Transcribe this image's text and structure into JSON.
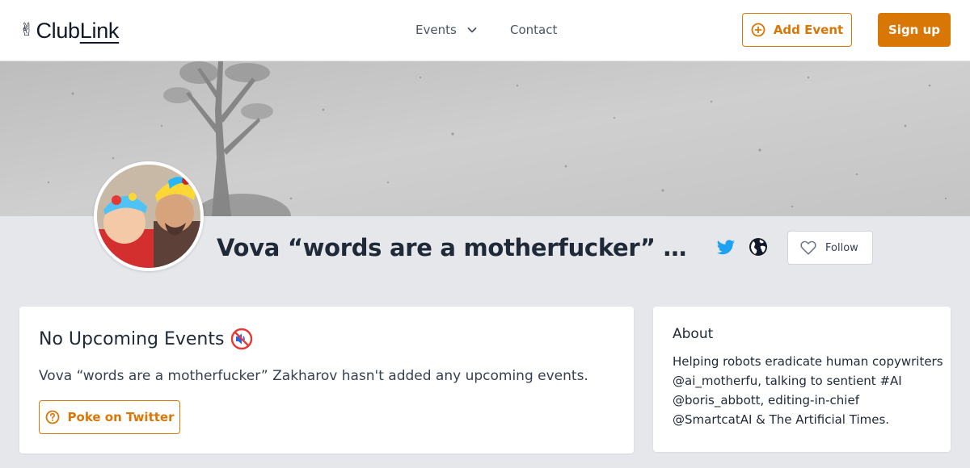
{
  "header": {
    "logo_hand": "✌",
    "logo_club": "Club",
    "logo_link": "Link",
    "nav": {
      "events_label": "Events",
      "contact_label": "Contact"
    },
    "add_event_label": "Add Event",
    "signup_label": "Sign up"
  },
  "profile": {
    "name": "Vova “words are a motherfucker” Zakharov",
    "follow_label": "Follow",
    "links": [
      "twitter-icon",
      "globe-icon"
    ]
  },
  "events": {
    "title": "No Upcoming Events",
    "title_icon": "muted-speaker-icon",
    "message": "Vova “words are a motherfucker” Zakharov hasn't added any upcoming events.",
    "poke_label": "Poke on Twitter"
  },
  "about": {
    "title": "About",
    "lines": [
      "Helping robots eradicate human copywriters",
      "@ai_motherfu, talking to sentient #AI",
      "@boris_abbott, editing-in-chief",
      "@SmartcatAI & The Artificial Times."
    ]
  },
  "colors": {
    "accent": "#d97706",
    "background": "#e5e7eb",
    "twitter": "#1da1f2"
  }
}
